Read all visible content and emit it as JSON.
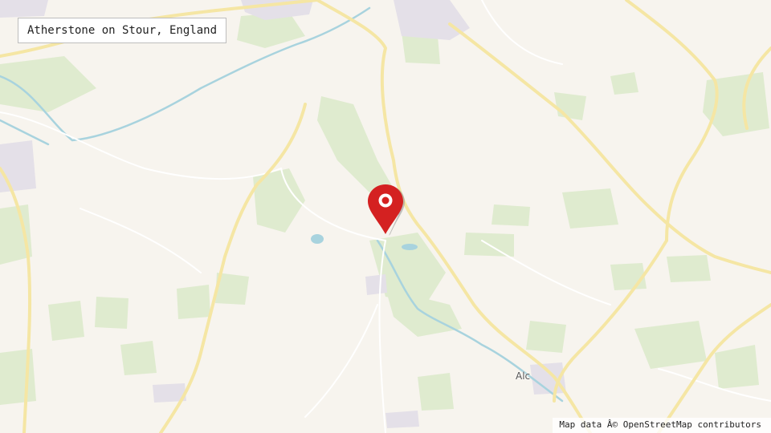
{
  "location": {
    "label": "Atherstone on Stour, England"
  },
  "map": {
    "town_label": "Alc",
    "attribution": "Map data Â© OpenStreetMap contributors"
  },
  "marker": {
    "icon": "map-pin-icon",
    "color": "#d42121"
  },
  "colors": {
    "background": "#f7f4ee",
    "woodland": "#dfebcf",
    "major_road": "#f5e6a4",
    "minor_road": "#ffffff",
    "water": "#a8d3de",
    "settlement": "#e4e0e8"
  }
}
